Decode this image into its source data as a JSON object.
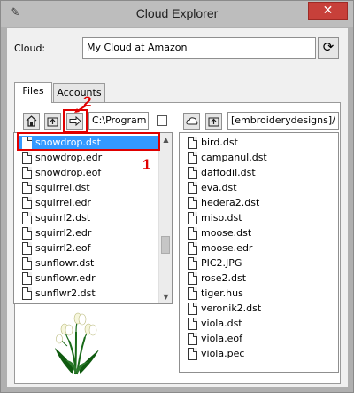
{
  "window": {
    "title": "Cloud Explorer",
    "close_glyph": "✕",
    "app_icon": "sewing-needle-icon"
  },
  "cloud": {
    "label": "Cloud:",
    "selected": "My Cloud at Amazon",
    "refresh_icon": "refresh-icon"
  },
  "tabs": [
    {
      "label": "Files",
      "active": true
    },
    {
      "label": "Accounts",
      "active": false
    }
  ],
  "local": {
    "path": "C:\\Program",
    "files": [
      "snowdrop.dst",
      "snowdrop.edr",
      "snowdrop.eof",
      "squirrel.dst",
      "squirrel.edr",
      "squirrl2.dst",
      "squirrl2.edr",
      "squirrl2.eof",
      "sunflowr.dst",
      "sunflowr.edr",
      "sunflwr2.dst"
    ],
    "selected_index": 0
  },
  "remote": {
    "path": "[embroiderydesigns]/",
    "files": [
      "bird.dst",
      "campanul.dst",
      "daffodil.dst",
      "eva.dst",
      "hedera2.dst",
      "miso.dst",
      "moose.dst",
      "moose.edr",
      "PIC2.JPG",
      "rose2.dst",
      "tiger.hus",
      "veronik2.dst",
      "viola.dst",
      "viola.eof",
      "viola.pec"
    ]
  },
  "annotations": {
    "one": "1",
    "two": "2",
    "accent": "#e00000"
  },
  "colors": {
    "selection": "#3399ff",
    "close": "#c7403a"
  }
}
